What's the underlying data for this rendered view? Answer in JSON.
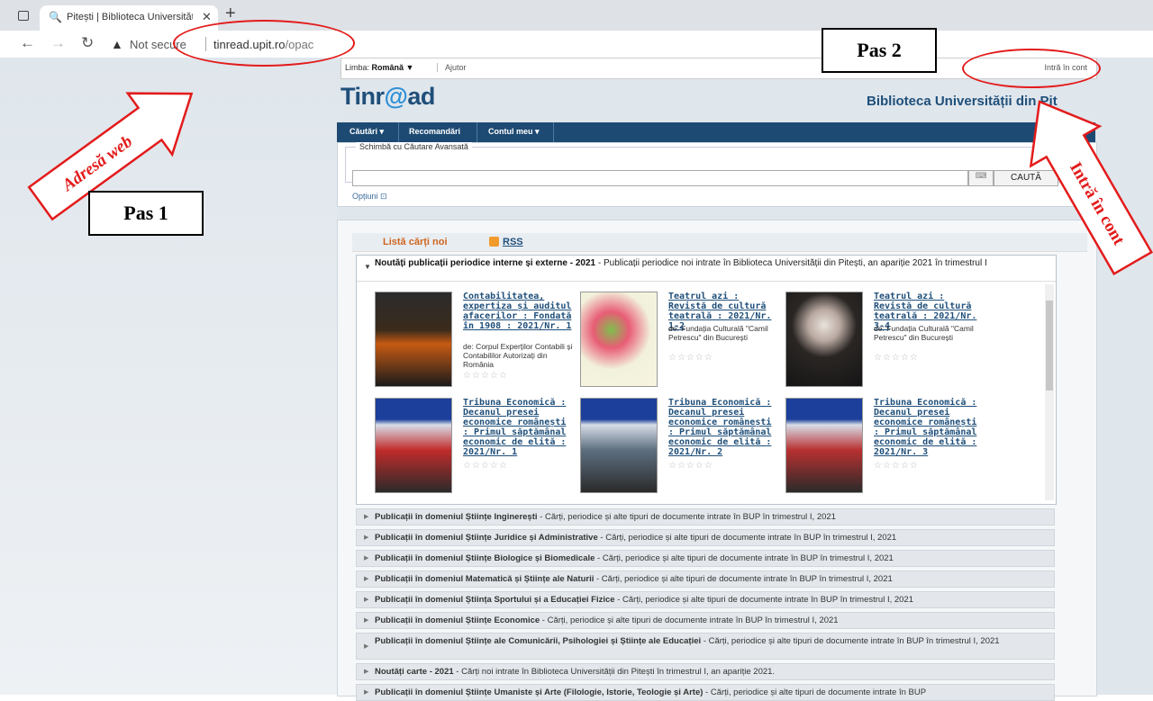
{
  "browser": {
    "tab_title": "Pitești | Biblioteca Universității | ...",
    "url_host": "tinread.upit.ro",
    "url_path": "/opac",
    "not_secure": "Not secure"
  },
  "topbar": {
    "lang_label": "Limba:",
    "lang_value": "Română ▼",
    "help": "Ajutor",
    "login": "Intră în cont"
  },
  "logo": {
    "text_a": "Tinr",
    "text_q": "@",
    "text_b": "ad"
  },
  "library_name": "Biblioteca Universității din Pit",
  "menu": [
    "Căutări ▾",
    "Recomandări",
    "Contul meu ▾"
  ],
  "search": {
    "legend_prefix": "Schimbă cu",
    "legend_link": "Căutare Avansată",
    "button": "CAUTĂ",
    "options": "Opțiuni ⊡"
  },
  "new_books": {
    "title": "Listă cărți noi",
    "rss": "RSS"
  },
  "panel": {
    "title": "Noutăți publicații periodice interne și externe - 2021",
    "desc": " - Publicații periodice noi intrate în Biblioteca Universității din Pitești, an apariție 2021 în trimestrul I"
  },
  "books": [
    {
      "title": "Contabilitatea, expertiza și auditul afacerilor : Fondată în 1908 : 2021/Nr. 1",
      "author": "de: Corpul Experților Contabili și Contabililor Autorizați din România"
    },
    {
      "title": "Teatrul azi : Revistă de cultură teatrală : 2021/Nr. 1-2",
      "author": "de: Fundația Culturală \"Camil Petrescu\" din București"
    },
    {
      "title": "Teatrul azi : Revistă de cultură teatrală : 2021/Nr. 3-4",
      "author": "de: Fundația Culturală \"Camil Petrescu\" din București"
    },
    {
      "title": "Tribuna Economică : Decanul presei economice românești : Primul săptămânal economic de elită : 2021/Nr. 1",
      "author": ""
    },
    {
      "title": "Tribuna Economică : Decanul presei economice românești : Primul săptămânal economic de elită : 2021/Nr. 2",
      "author": ""
    },
    {
      "title": "Tribuna Economică : Decanul presei economice românești : Primul săptămânal economic de elită : 2021/Nr. 3",
      "author": ""
    }
  ],
  "stars": "☆☆☆☆☆",
  "categories": [
    {
      "bold": "Publicații în domeniul Științe Inginerești",
      "rest": " - Cărți, periodice și alte tipuri de documente intrate în BUP în trimestrul I, 2021"
    },
    {
      "bold": "Publicații în domeniul Științe Juridice și Administrative",
      "rest": " - Cărți, periodice și alte tipuri de documente intrate în BUP în trimestrul I, 2021"
    },
    {
      "bold": "Publicații în domeniul Științe Biologice și Biomedicale",
      "rest": " - Cărți, periodice și alte tipuri de documente intrate în BUP în trimestrul I, 2021"
    },
    {
      "bold": "Publicații în domeniul Matematică și Științe ale Naturii",
      "rest": " - Cărți, periodice și alte tipuri de documente intrate în BUP în trimestrul I, 2021"
    },
    {
      "bold": "Publicații în domeniul Știința Sportului și a Educației Fizice",
      "rest": " - Cărți, periodice și alte tipuri de documente intrate în BUP în trimestrul I, 2021"
    },
    {
      "bold": "Publicații în domeniul Științe Economice",
      "rest": " - Cărți, periodice și alte tipuri de documente intrate în BUP în trimestrul I, 2021"
    },
    {
      "bold": "Publicații în domeniul Științe ale Comunicării, Psihologiei și Științe ale Educației",
      "rest": " - Cărți, periodice și alte tipuri de documente intrate în BUP în trimestrul I, 2021"
    },
    {
      "bold": "Noutăți carte - 2021",
      "rest": " - Cărți noi intrate în Biblioteca Universității din Pitești în trimestrul I, an apariție 2021."
    },
    {
      "bold": "Publicații în domeniul Științe Umaniste și Arte (Filologie, Istorie, Teologie și Arte)",
      "rest": " - Cărți, periodice și alte tipuri de documente intrate în BUP"
    }
  ],
  "annotations": {
    "pas1": "Pas 1",
    "pas2": "Pas 2",
    "adresa": "Adresă web",
    "intra": "Intră în cont"
  }
}
